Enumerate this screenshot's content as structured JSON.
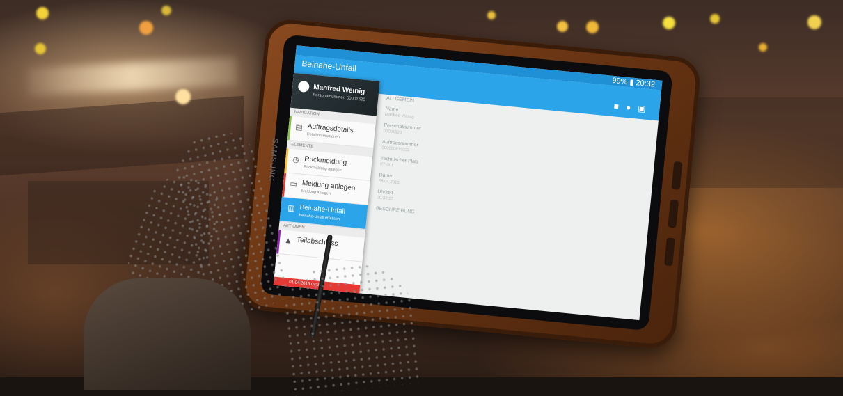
{
  "tablet": {
    "brand": "SAMSUNG",
    "status": {
      "battery": "99%",
      "time": "20:32"
    },
    "app_title": "Beinahe-Unfall",
    "toolbar_icons": [
      "save-icon",
      "camera-icon",
      "gallery-icon"
    ],
    "profile": {
      "name": "Manfred Weinig",
      "personnel_number": "Personalnummer: 00001520"
    },
    "sections": {
      "navigation": "NAVIGATION",
      "elements": "ELEMENTE",
      "actions": "AKTIONEN"
    },
    "nav_items": [
      {
        "label": "Auftragsdetails",
        "sub": "Detailinformationen",
        "icon": "document-icon",
        "accent": "#8bc34a"
      },
      {
        "label": "Rückmeldung",
        "sub": "Rückmeldung anlegen",
        "icon": "alarm-icon",
        "accent": "#fbc02d"
      },
      {
        "label": "Meldung anlegen",
        "sub": "Meldung anlegen",
        "icon": "message-icon",
        "accent": "#e53935"
      },
      {
        "label": "Beinahe-Unfall",
        "sub": "Beinahe-Unfall erfassen",
        "icon": "chart-icon",
        "accent": "#2ba4ea",
        "active": true
      }
    ],
    "action_item": {
      "label": "Teilabschluss",
      "icon": "upload-icon",
      "accent": "#8e24aa"
    },
    "bottom_status": "01.04.2015 09:23",
    "content": {
      "group": "ALLGEMEIN",
      "fields": [
        {
          "key": "Name",
          "value": "Manfred Weinig"
        },
        {
          "key": "Personalnummer",
          "value": "00001520"
        },
        {
          "key": "Auftragsnummer",
          "value": "000000815023"
        },
        {
          "key": "Technischer Platz",
          "value": "KT-001"
        },
        {
          "key": "Datum",
          "value": "28.04.2015"
        },
        {
          "key": "Uhrzeit",
          "value": "20:32:17"
        }
      ],
      "group2": "BESCHREIBUNG"
    }
  }
}
